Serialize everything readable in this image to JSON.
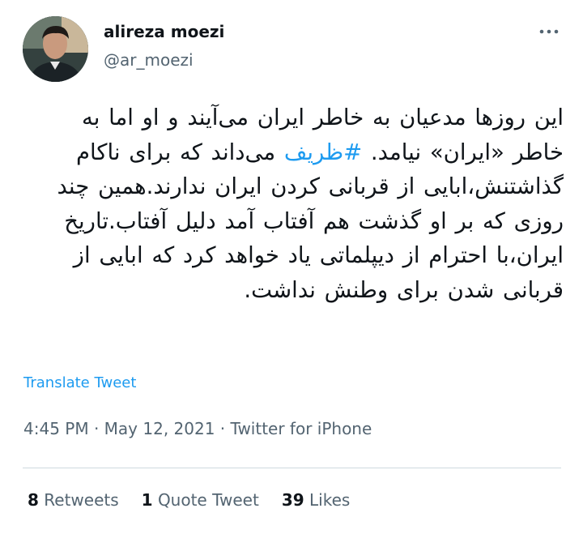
{
  "author": {
    "display_name": "alireza moezi",
    "handle": "@ar_moezi",
    "avatar_icon": "profile-photo"
  },
  "menu_icon": "more-horizontal-icon",
  "tweet": {
    "text_before_hashtag": "این روزها مدعیان به خاطر ایران می‌آیند و او اما به خاطر «ایران» نیامد. ",
    "hashtag": "#ظریف",
    "text_after_hashtag": " می‌داند که برای ناکام گذاشتنش،ابایی از قربانی کردن ایران ندارند.همین چند روزی که بر او گذشت هم آفتاب آمد دلیل آفتاب.تاریخ ایران،با احترام از دیپلماتی یاد خواهد کرد که ابایی از قربانی شدن برای وطنش نداشت."
  },
  "translate_label": "Translate Tweet",
  "meta": {
    "time": "4:45 PM",
    "separator": " · ",
    "date": "May 12, 2021",
    "source": "Twitter for iPhone"
  },
  "stats": {
    "retweets_count": "8",
    "retweets_label": "Retweets",
    "quotes_count": "1",
    "quotes_label": "Quote Tweet",
    "likes_count": "39",
    "likes_label": "Likes"
  },
  "colors": {
    "link": "#1d9bf0",
    "secondary_text": "#536471",
    "primary_text": "#0f1419",
    "divider": "#cfd9de"
  }
}
